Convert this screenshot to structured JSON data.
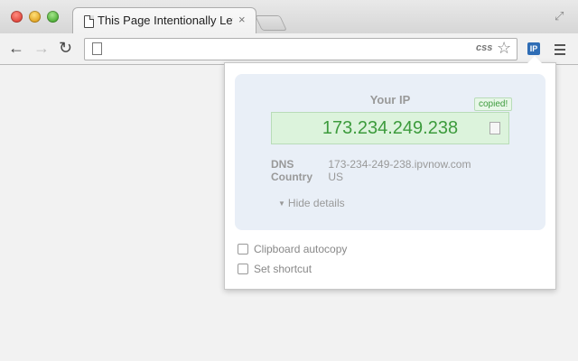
{
  "browser": {
    "tab_title": "This Page Intentionally Left B",
    "tab_close": "×",
    "css_badge": "css",
    "extension_label": "IP"
  },
  "popup": {
    "heading": "Your IP",
    "ip": "173.234.249.238",
    "copied_badge": "copied!",
    "details": [
      {
        "key": "DNS",
        "value": "173-234-249-238.ipvnow.com"
      },
      {
        "key": "Country",
        "value": "US"
      }
    ],
    "hide_details": "Hide details",
    "options": [
      {
        "label": "Clipboard autocopy",
        "checked": false
      },
      {
        "label": "Set shortcut",
        "checked": false
      }
    ]
  },
  "icons": [
    "page-icon",
    "back-arrow-icon",
    "forward-arrow-icon",
    "reload-icon",
    "star-icon",
    "menu-icon",
    "copy-icon",
    "fullscreen-icon"
  ],
  "colors": {
    "ip_text": "#3c9b3c",
    "ip_box_bg": "#dcf3dc",
    "panel_bg": "#e9eff7",
    "extension_bg": "#2f6db5"
  }
}
